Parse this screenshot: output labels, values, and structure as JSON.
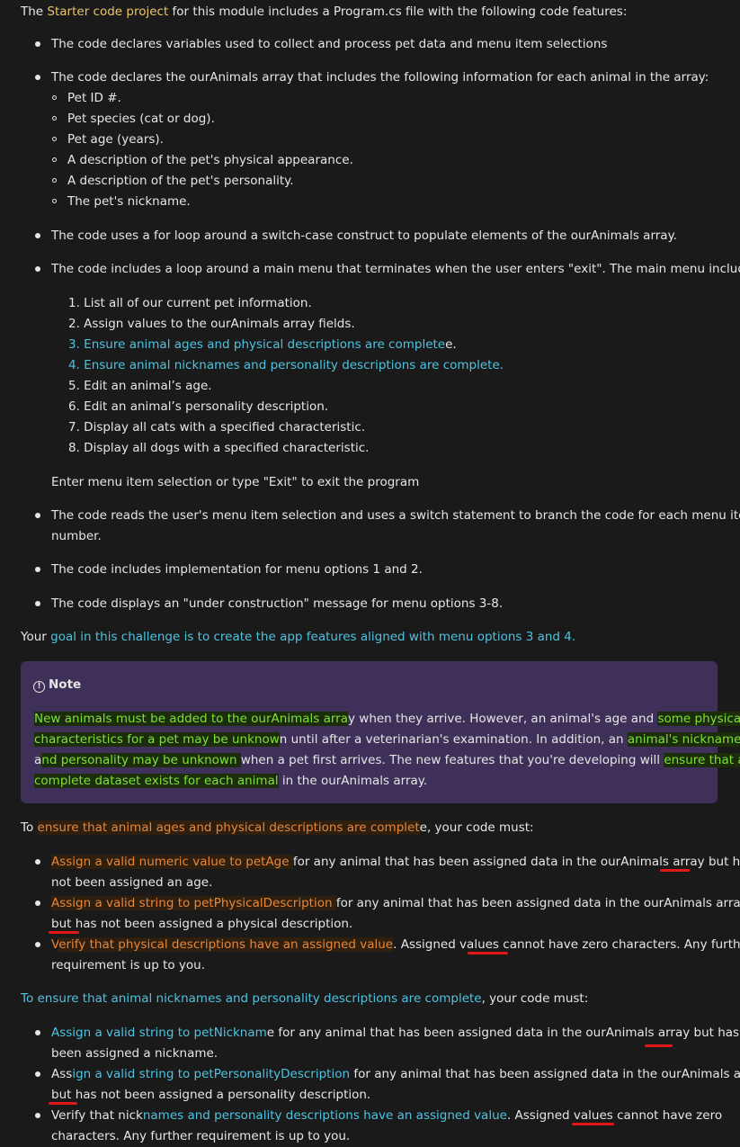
{
  "intro": {
    "prefix": "The ",
    "link": "Starter code project",
    "suffix": " for this module includes a Program.cs file with the following code features:"
  },
  "features": [
    "The code declares variables used to collect and process pet data and menu item selections",
    "The code declares the ourAnimals array that includes the following information for each animal in the array:",
    "The code uses a for loop around a switch-case construct to populate elements of the ourAnimals array.",
    "The code includes a loop around a main menu that terminates when the user enters \"exit\". The main menu includes:"
  ],
  "animal_fields": [
    "Pet ID #.",
    "Pet species (cat or dog).",
    "Pet age (years).",
    "A description of the pet's physical appearance.",
    "A description of the pet's personality.",
    "The pet's nickname."
  ],
  "menu": [
    "1. List all of our current pet information.",
    "2. Assign values to the ourAnimals array fields.",
    "3. Ensure animal ages and physical descriptions are complete",
    "e.",
    "4. Ensure animal nicknames and personality descriptions are complete.",
    "5. Edit an animal’s age.",
    "6. Edit an animal’s personality description.",
    "7. Display all cats with a specified characteristic.",
    "8. Display all dogs with a specified characteristic."
  ],
  "menu_prompt": "Enter menu item selection or type \"Exit\" to exit the program",
  "features2": [
    "The code reads the user's menu item selection and uses a switch statement to branch the code for each menu item",
    "number.",
    "The code includes implementation for menu options 1 and 2.",
    "The code displays an \"under construction\" message for menu options 3-8."
  ],
  "goal": {
    "prefix": "Your ",
    "highlight": "goal in this challenge is to create the app features aligned with menu options 3 and 4."
  },
  "note": {
    "icon": "info-icon",
    "title": "Note",
    "l1a": "New animals must be added to the ourAnimals arra",
    "l1b": "y when they arrive. However, an animal's age and ",
    "l1c": "some physical",
    "l2a": "characteristics for a pet may be unknow",
    "l2b": "n until after a veterinarian's examination. In addition, an ",
    "l2c": "animal's nickname",
    "l3a": "a",
    "l3b": "nd personality may be unknown ",
    "l3c": "when a pet first arrives. The new features that you're developing will ",
    "l3d": "ensure that a",
    "l4a": "complete dataset exists for each animal",
    "l4b": " in the ourAnimals array."
  },
  "section1": {
    "prefix": "To ",
    "highlight": "ensure that animal ages and physical descriptions are complet",
    "rest": "e, your code must:",
    "b1a": "Assign a valid numeric value to petAge ",
    "b1b": "for any animal that has been assigned data in the ourAnimals array ",
    "b1c": "but",
    "b1d": " has",
    "b1e": "not been assigned an age.",
    "b2a": "Assign a valid string to petPhysicalDescription ",
    "b2b": "for any animal that has been assigned data in the ourAnimals array",
    "b2c": "but",
    "b2d": " has not been assigned a physical description.",
    "b3a": "V",
    "b3b": "erify that physical descriptions have an assigned value",
    "b3c": ". Assigned values ",
    "b3d": "cannot",
    "b3e": " have zero characters. Any further",
    "b3f": "requirement is up to you."
  },
  "section2": {
    "heading_a": "To ensure",
    "heading_b": " that animal nicknames and personality descriptions are complete",
    "heading_c": ", your code must:",
    "b1a": "Assign a valid string to petNicknam",
    "b1b": "e for any animal that has been assigned data in the ourAnimals array ",
    "b1c": "but",
    "b1d": " has not",
    "b1e": "been assigned a nickname.",
    "b2a": "Ass",
    "b2b": "ign a valid string to petPersonalityDescription",
    "b2c": " for any animal that has been assigned data in the ourAnimals array",
    "b2d": "but",
    "b2e": " has not been assigned a personality description.",
    "b3a": "Verify that nick",
    "b3b": "names and personality descriptions have an assigned value",
    "b3c": ". Assigned values ",
    "b3d": "cannot",
    "b3e": " have zero",
    "b3f": "characters. Any further requirement is up to you."
  },
  "colors": {
    "background": "#1a1a1a",
    "text": "#e6e6e6",
    "link_yellow": "#e9c46a",
    "link_cyan": "#4fc3e0",
    "highlight_green": "#7ee03a",
    "highlight_orange": "#e8873a",
    "note_background": "#3e3058",
    "annotation_red": "#e01818"
  }
}
